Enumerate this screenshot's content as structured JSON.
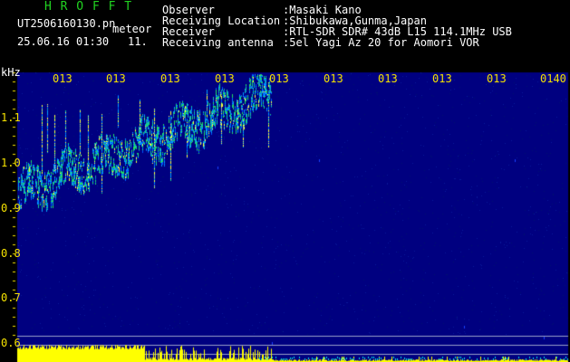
{
  "header": {
    "app_title": "H R O F F T",
    "file_name": "UT2506160130.pn",
    "file_suffix": "meteor",
    "date_time": "25.06.16 01:30",
    "extra": "11.",
    "info": [
      {
        "label": "Observer",
        "value": ":Masaki Kano"
      },
      {
        "label": "Receiving Location",
        "value": ":Shibukawa,Gunma,Japan"
      },
      {
        "label": "Receiver",
        "value": ":RTL-SDR SDR# 43dB L15 114.1MHz USB"
      },
      {
        "label": "Receiving antenna",
        "value": ":5el Yagi Az 20 for Aomori VOR"
      }
    ]
  },
  "axis": {
    "unit": "kHz",
    "freq_labels": [
      "1.1",
      "1.0",
      "0.9",
      "0.8",
      "0.7",
      "0.6"
    ],
    "time_labels": [
      "013",
      "013",
      "013",
      "013",
      "013",
      "013",
      "013",
      "013",
      "013",
      "0140"
    ]
  },
  "colors": {
    "background": "#000080",
    "frame": "#000000",
    "label_yellow": "#f5e200",
    "title_green": "#21d321",
    "level_bar": "#ffff00",
    "level_cyan": "#00e0e0"
  }
}
